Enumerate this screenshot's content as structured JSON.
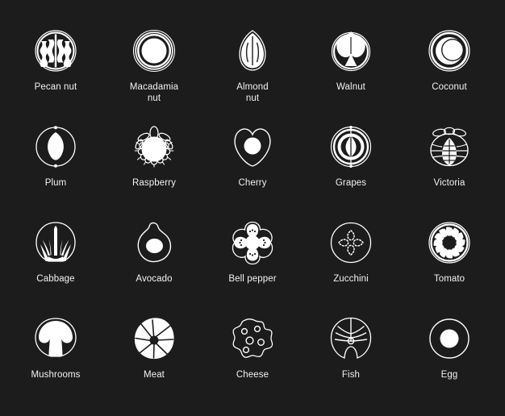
{
  "page": {
    "title": "Food Icons Grid",
    "background_color": "#1c1c1c",
    "icon_color": "#ffffff",
    "label_color": "#f2f2f2",
    "columns": 5,
    "rows": 4
  },
  "icons": [
    {
      "label": "Pecan nut",
      "icon_name": "pecan-nut-icon",
      "row": 1,
      "col": 1
    },
    {
      "label": "Macadamia\nnut",
      "icon_name": "macadamia-nut-icon",
      "row": 1,
      "col": 2
    },
    {
      "label": "Almond\nnut",
      "icon_name": "almond-nut-icon",
      "row": 1,
      "col": 3
    },
    {
      "label": "Walnut",
      "icon_name": "walnut-icon",
      "row": 1,
      "col": 4
    },
    {
      "label": "Coconut",
      "icon_name": "coconut-icon",
      "row": 1,
      "col": 5
    },
    {
      "label": "Plum",
      "icon_name": "plum-icon",
      "row": 2,
      "col": 1
    },
    {
      "label": "Raspberry",
      "icon_name": "raspberry-icon",
      "row": 2,
      "col": 2
    },
    {
      "label": "Cherry",
      "icon_name": "cherry-icon",
      "row": 2,
      "col": 3
    },
    {
      "label": "Grapes",
      "icon_name": "grapes-icon",
      "row": 2,
      "col": 4
    },
    {
      "label": "Victoria",
      "icon_name": "victoria-icon",
      "row": 2,
      "col": 5
    },
    {
      "label": "Cabbage",
      "icon_name": "cabbage-icon",
      "row": 3,
      "col": 1
    },
    {
      "label": "Avocado",
      "icon_name": "avocado-icon",
      "row": 3,
      "col": 2
    },
    {
      "label": "Bell pepper",
      "icon_name": "bell-pepper-icon",
      "row": 3,
      "col": 3
    },
    {
      "label": "Zucchini",
      "icon_name": "zucchini-icon",
      "row": 3,
      "col": 4
    },
    {
      "label": "Tomato",
      "icon_name": "tomato-icon",
      "row": 3,
      "col": 5
    },
    {
      "label": "Mushrooms",
      "icon_name": "mushrooms-icon",
      "row": 4,
      "col": 1
    },
    {
      "label": "Meat",
      "icon_name": "meat-icon",
      "row": 4,
      "col": 2
    },
    {
      "label": "Cheese",
      "icon_name": "cheese-icon",
      "row": 4,
      "col": 3
    },
    {
      "label": "Fish",
      "icon_name": "fish-icon",
      "row": 4,
      "col": 4
    },
    {
      "label": "Egg",
      "icon_name": "egg-icon",
      "row": 4,
      "col": 5
    }
  ]
}
